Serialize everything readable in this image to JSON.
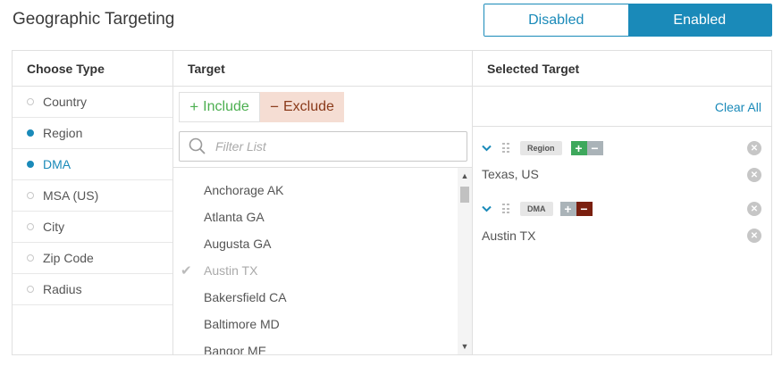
{
  "header": {
    "title": "Geographic Targeting"
  },
  "toggle": {
    "disabled_label": "Disabled",
    "enabled_label": "Enabled",
    "active": "Enabled"
  },
  "columns": {
    "choose_type": "Choose Type",
    "target": "Target",
    "selected_target": "Selected Target"
  },
  "types": [
    {
      "label": "Country",
      "selected": false
    },
    {
      "label": "Region",
      "selected": true
    },
    {
      "label": "DMA",
      "selected": true,
      "active": true
    },
    {
      "label": "MSA (US)",
      "selected": false
    },
    {
      "label": "City",
      "selected": false
    },
    {
      "label": "Zip Code",
      "selected": false
    },
    {
      "label": "Radius",
      "selected": false
    }
  ],
  "actions": {
    "include_label": "Include",
    "exclude_label": "Exclude",
    "include_symbol": "+",
    "exclude_symbol": "−"
  },
  "filter": {
    "placeholder": "Filter List",
    "value": ""
  },
  "targets": [
    {
      "label": "Anchorage AK",
      "checked": false
    },
    {
      "label": "Atlanta GA",
      "checked": false
    },
    {
      "label": "Augusta GA",
      "checked": false
    },
    {
      "label": "Austin TX",
      "checked": true
    },
    {
      "label": "Bakersfield CA",
      "checked": false
    },
    {
      "label": "Baltimore MD",
      "checked": false
    },
    {
      "label": "Bangor ME",
      "checked": false
    }
  ],
  "selected": {
    "clear_all_label": "Clear All",
    "groups": [
      {
        "tag": "Region",
        "mode": "include",
        "value": "Texas, US"
      },
      {
        "tag": "DMA",
        "mode": "exclude",
        "value": "Austin TX"
      }
    ]
  },
  "colors": {
    "accent": "#1a8ab9",
    "include": "#3ea85c",
    "exclude": "#7a1f0f",
    "exclude_bg": "#f5ddd3"
  },
  "icons": {
    "search": "search-icon",
    "check": "check-icon",
    "chevron": "chevron-down-icon",
    "grip": "drag-handle-icon",
    "remove": "close-circle-icon"
  }
}
